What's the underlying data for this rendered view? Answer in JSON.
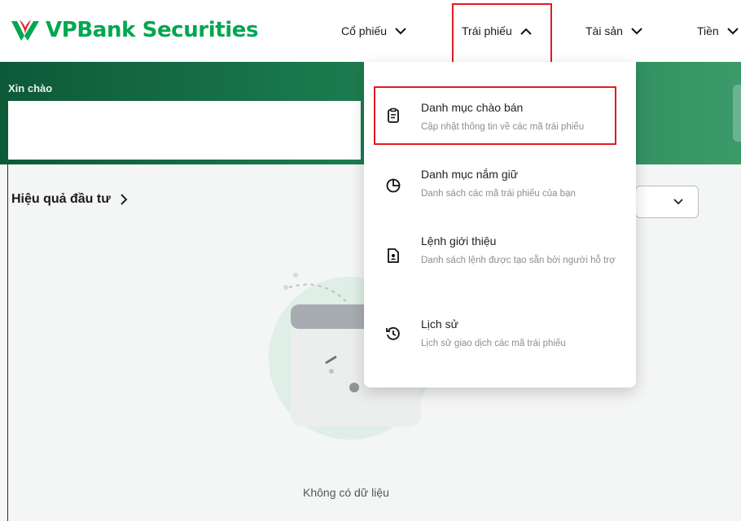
{
  "brand": {
    "name_main": "VPBan",
    "name_k": "k",
    "name_rest": " Securities",
    "primary": "#00a651",
    "accent": "#e11b22"
  },
  "nav": {
    "items": [
      {
        "label": "Cổ phiếu",
        "icon": "chevron-down-icon"
      },
      {
        "label": "Trái phiếu",
        "icon": "chevron-up-icon"
      },
      {
        "label": "Tài sản",
        "icon": "chevron-down-icon"
      },
      {
        "label": "Tiền",
        "icon": "chevron-down-icon"
      }
    ]
  },
  "banner": {
    "greeting": "Xin chào"
  },
  "main": {
    "performance_label": "Hiệu quả đầu tư",
    "empty_text": "Không có dữ liệu"
  },
  "dropdown": {
    "items": [
      {
        "title": "Danh mục chào bán",
        "desc": "Cập nhật thông tin về các mã trái phiếu",
        "icon": "clipboard-icon"
      },
      {
        "title": "Danh mục nắm giữ",
        "desc": "Danh sách các mã trái phiếu của bạn",
        "icon": "pie-chart-icon"
      },
      {
        "title": "Lệnh giới thiệu",
        "desc": "Danh sách lệnh được tạo sẵn bởi người hỗ trợ",
        "icon": "document-user-icon"
      },
      {
        "title": "Lịch sử",
        "desc": "Lịch sử giao dịch các mã trái phiếu",
        "icon": "history-icon"
      }
    ]
  }
}
